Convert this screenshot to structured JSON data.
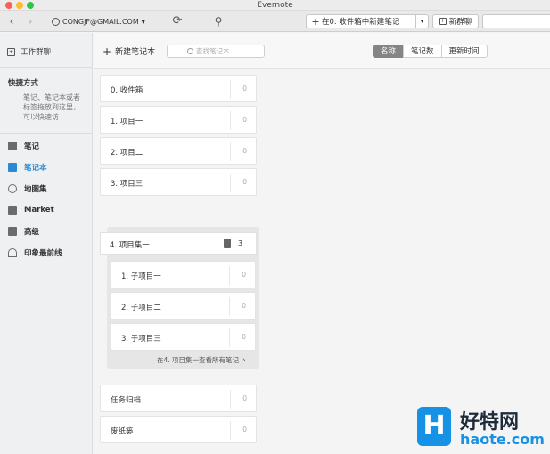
{
  "window": {
    "title": "Evernote"
  },
  "toolbar": {
    "account": "CONGJF@GMAIL.COM",
    "account_caret": "▾",
    "new_note_label": "在0. 收件箱中新建笔记",
    "new_chat_label": "新群聊",
    "icons": [
      "back-arrow-icon",
      "forward-arrow-icon",
      "user-icon",
      "sync-icon",
      "pin-icon",
      "plus-icon",
      "new-chat-icon"
    ]
  },
  "sidebar": {
    "work_chat": "工作群聊",
    "shortcuts_heading": "快捷方式",
    "shortcuts_hint": "笔记、笔记本或者标签拖放到这里，可以快速访",
    "items": [
      {
        "label": "笔记",
        "icon": "note-icon",
        "active": false
      },
      {
        "label": "笔记本",
        "icon": "notebook-icon",
        "active": true
      },
      {
        "label": "地图集",
        "icon": "atlas-icon",
        "active": false
      },
      {
        "label": "Market",
        "icon": "market-icon",
        "active": false
      },
      {
        "label": "高级",
        "icon": "premium-icon",
        "active": false
      },
      {
        "label": "印象最前线",
        "icon": "frontline-icon",
        "active": false
      }
    ],
    "accent_color": "#2c8ad3"
  },
  "main": {
    "add_notebook": "新建笔记本",
    "search_placeholder": "查找笔记本",
    "sort": [
      {
        "label": "名称",
        "active": true
      },
      {
        "label": "笔记数",
        "active": false
      },
      {
        "label": "更新时间",
        "active": false
      }
    ],
    "notebooks": [
      {
        "name": "0. 收件箱",
        "count": "0"
      },
      {
        "name": "1. 项目一",
        "count": "0"
      },
      {
        "name": "2. 项目二",
        "count": "0"
      },
      {
        "name": "3. 项目三",
        "count": "0"
      }
    ],
    "stack": {
      "name": "4. 项目集一",
      "count": "3",
      "children": [
        {
          "name": "1. 子项目一",
          "count": "0"
        },
        {
          "name": "2. 子项目二",
          "count": "0"
        },
        {
          "name": "3. 子项目三",
          "count": "0"
        }
      ],
      "view_all": "在4. 项目集一查看所有笔记"
    },
    "bottom": [
      {
        "name": "任务归档",
        "count": "0"
      },
      {
        "name": "废纸篓",
        "count": "0"
      }
    ]
  },
  "watermark": {
    "logo": "H",
    "cn": "好特网",
    "en": "haote.com"
  }
}
